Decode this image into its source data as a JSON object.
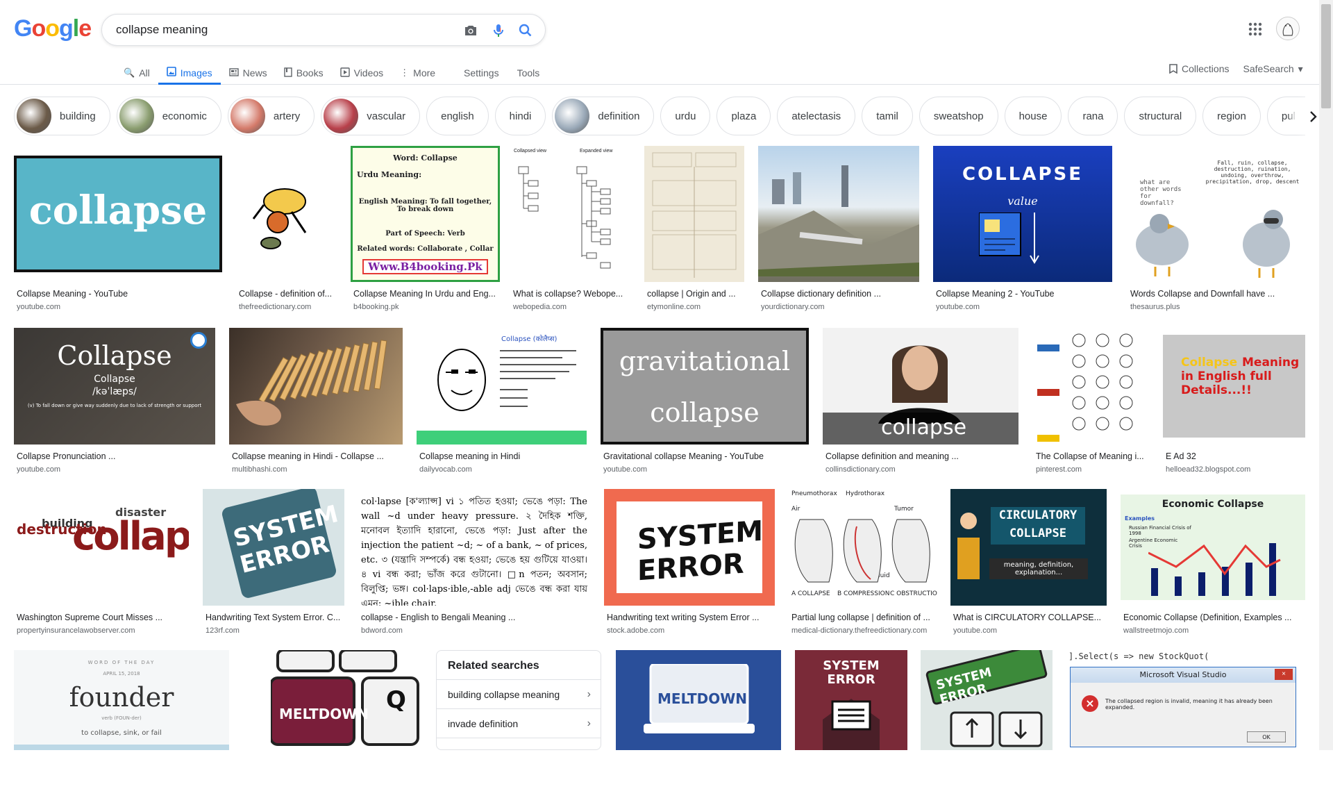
{
  "logo": {
    "text": "Google",
    "colors": [
      "#4285F4",
      "#EA4335",
      "#FBBC05",
      "#4285F4",
      "#34A853",
      "#EA4335"
    ]
  },
  "search": {
    "query": "collapse meaning"
  },
  "tabs": [
    {
      "label": "All",
      "icon": "search-icon",
      "active": false
    },
    {
      "label": "Images",
      "icon": "image-icon",
      "active": true
    },
    {
      "label": "News",
      "icon": "news-icon",
      "active": false
    },
    {
      "label": "Books",
      "icon": "book-icon",
      "active": false
    },
    {
      "label": "Videos",
      "icon": "video-icon",
      "active": false
    },
    {
      "label": "More",
      "icon": "more-vert-icon",
      "active": false
    }
  ],
  "tools": {
    "settings": "Settings",
    "tools": "Tools"
  },
  "right_tools": {
    "collections": "Collections",
    "safesearch": "SafeSearch"
  },
  "chips": [
    {
      "label": "building",
      "thumb": true,
      "color": "#6b5a48"
    },
    {
      "label": "economic",
      "thumb": true,
      "color": "#8a9d6f"
    },
    {
      "label": "artery",
      "thumb": true,
      "color": "#d47a6a"
    },
    {
      "label": "vascular",
      "thumb": true,
      "color": "#b8404a"
    },
    {
      "label": "english",
      "thumb": false
    },
    {
      "label": "hindi",
      "thumb": false
    },
    {
      "label": "definition",
      "thumb": true,
      "color": "#9aa9b8"
    },
    {
      "label": "urdu",
      "thumb": false
    },
    {
      "label": "plaza",
      "thumb": false
    },
    {
      "label": "atelectasis",
      "thumb": false
    },
    {
      "label": "tamil",
      "thumb": false
    },
    {
      "label": "sweatshop",
      "thumb": false
    },
    {
      "label": "house",
      "thumb": false
    },
    {
      "label": "rana",
      "thumb": false
    },
    {
      "label": "structural",
      "thumb": false
    },
    {
      "label": "region",
      "thumb": false
    },
    {
      "label": "pulmonary",
      "thumb": false
    }
  ],
  "results": [
    {
      "caption": "Collapse Meaning - YouTube",
      "source": "youtube.com",
      "text": "collapse"
    },
    {
      "caption": "Collapse - definition of...",
      "source": "thefreedictionary.com",
      "text": ""
    },
    {
      "caption": "Collapse Meaning In Urdu and Eng...",
      "source": "b4booking.pk",
      "text": "Word: Collapse",
      "text2": "Urdu Meaning:",
      "text3": "English Meaning: To fall together, To break down",
      "text4": "Part of Speech: Verb",
      "text5": "Related words: Collaborate , Collar",
      "text6": "Www.B4booking.Pk"
    },
    {
      "caption": "What is collapse? Webope...",
      "source": "webopedia.com",
      "text": "Collapsed view",
      "text2": "Expanded view"
    },
    {
      "caption": "collapse | Origin and ...",
      "source": "etymonline.com",
      "text": ""
    },
    {
      "caption": "Collapse dictionary definition ...",
      "source": "yourdictionary.com",
      "text": ""
    },
    {
      "caption": "Collapse Meaning 2 - YouTube",
      "source": "youtube.com",
      "text": "COLLAPSE",
      "text2": "value"
    },
    {
      "caption": "Words Collapse and Downfall have ...",
      "source": "thesaurus.plus",
      "text": "what are other words for downfall?",
      "text2": "Fall, ruin, collapse, destruction, ruination, undoing, overthrow, precipitation, drop, descent"
    },
    {
      "caption": "Collapse Pronunciation ...",
      "source": "youtube.com",
      "text": "Collapse",
      "text2": "Collapse",
      "text3": "/kəˈlæps/",
      "text4": "(v) To fall down or give way suddenly due to lack of strength or support"
    },
    {
      "caption": "Collapse meaning in Hindi - Collapse ...",
      "source": "multibhashi.com",
      "text": ""
    },
    {
      "caption": "Collapse meaning in Hindi",
      "source": "dailyvocab.com",
      "text": "Collapse (कोलैप्स)"
    },
    {
      "caption": "Gravitational collapse Meaning - YouTube",
      "source": "youtube.com",
      "text": "gravitational",
      "text2": "collapse"
    },
    {
      "caption": "Collapse definition and meaning ...",
      "source": "collinsdictionary.com",
      "text": "collapse"
    },
    {
      "caption": "The Collapse of Meaning i...",
      "source": "pinterest.com",
      "text": ""
    },
    {
      "caption": "E Ad 32",
      "source": "helloead32.blogspot.com",
      "text": "Collapse",
      "text2": "Meaning in English full Details...!!"
    },
    {
      "caption": "Washington Supreme Court Misses ...",
      "source": "propertyinsurancelawobserver.com",
      "text": "collapse",
      "text2": "destruction",
      "text3": "disaster",
      "text4": "building"
    },
    {
      "caption": "Handwriting Text System Error. C...",
      "source": "123rf.com",
      "text": "SYSTEM",
      "text2": "ERROR"
    },
    {
      "caption": "collapse - English to Bengali Meaning ...",
      "source": "bdword.com",
      "text": "col·lapse [ক'ল্যাপ্স] vi ১ পতিত হওয়া; ভেঙে পড়া: The wall ~d under heavy pressure. ২ দৈহিক শক্তি, মনোবল ইত্যাদি হারানো, ভেঙে পড়া: Just after the injection the patient ~d; ~ of a bank, ~ of prices, etc. ৩ (যন্ত্রাদি সম্পর্কে) বন্ধ হওয়া; ভেঙে হয় গুটিয়ে যাওয়া। ৪ vi বন্ধ করা; ভাঁজ করে গুটানো। □n পতন; অবসান; বিলুপ্তি; ভঙ্গ। col·laps·ible,-able adj ভেঙে বন্ধ করা যায় এমন: ~ible chair."
    },
    {
      "caption": "Handwriting text writing System Error ...",
      "source": "stock.adobe.com",
      "text": "SYSTEM",
      "text2": "ERROR"
    },
    {
      "caption": "Partial lung collapse | definition of ...",
      "source": "medical-dictionary.thefreedictionary.com",
      "text": "Pneumothorax",
      "text2": "Hydrothorax",
      "text3": "Air",
      "text4": "Tumor",
      "text5": "Fluid",
      "text6": "A COLLAPSE",
      "text7": "B COMPRESSION",
      "text8": "C OBSTRUCTION"
    },
    {
      "caption": "What is CIRCULATORY COLLAPSE...",
      "source": "youtube.com",
      "text": "CIRCULATORY",
      "text2": "COLLAPSE",
      "text3": "meaning, definition, explanation..."
    },
    {
      "caption": "Economic Collapse (Definition, Examples ...",
      "source": "wallstreetmojo.com",
      "text": "Economic Collapse",
      "text2": "Examples",
      "text3": "Russian Financial Crisis of 1998",
      "text4": "Argentine Economic Crisis"
    },
    {
      "caption": "",
      "source": "",
      "text": "WORD OF THE DAY",
      "text2": "APRIL 15, 2018",
      "text3": "founder",
      "text4": "verb (FOUN-der)",
      "text5": "to collapse, sink, or fail"
    },
    {
      "caption": "",
      "source": "",
      "text": "MELTDOWN",
      "text2": "Q"
    },
    {
      "caption": "",
      "source": "",
      "text": "MELTDOWN"
    },
    {
      "caption": "",
      "source": "",
      "text": "SYSTEM",
      "text2": "ERROR"
    },
    {
      "caption": "",
      "source": "",
      "text": "SYSTEM ERROR"
    },
    {
      "caption": "",
      "source": "",
      "text": "Microsoft Visual Studio",
      "text2": "The collapsed region is invalid, meaning it has already been expanded.",
      "text3": "OK",
      "text4": "].Select(s => new StockQuot("
    }
  ],
  "related": {
    "title": "Related searches",
    "items": [
      "building collapse meaning",
      "invade definition"
    ]
  },
  "colors": {
    "accent": "#1a73e8",
    "border": "#dfe1e5",
    "text_secondary": "#5f6368"
  }
}
